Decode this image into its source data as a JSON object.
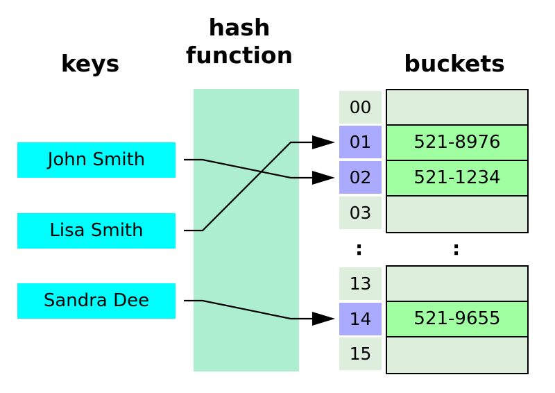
{
  "headings": {
    "keys": "keys",
    "hash_function_line1": "hash",
    "hash_function_line2": "function",
    "buckets": "buckets"
  },
  "keys": [
    {
      "label": "John Smith",
      "bucket": "02"
    },
    {
      "label": "Lisa Smith",
      "bucket": "01"
    },
    {
      "label": "Sandra Dee",
      "bucket": "14"
    }
  ],
  "buckets_top": [
    {
      "index": "00",
      "value": "",
      "hit": false
    },
    {
      "index": "01",
      "value": "521-8976",
      "hit": true
    },
    {
      "index": "02",
      "value": "521-1234",
      "hit": true
    },
    {
      "index": "03",
      "value": "",
      "hit": false
    }
  ],
  "buckets_bottom": [
    {
      "index": "13",
      "value": "",
      "hit": false
    },
    {
      "index": "14",
      "value": "521-9655",
      "hit": true
    },
    {
      "index": "15",
      "value": "",
      "hit": false
    }
  ],
  "ellipsis": ":",
  "colors": {
    "key_fill": "#00ffff",
    "hash_band": "#aeeed0",
    "index_hit": "#aaaaff",
    "index_empty": "#ddeedd",
    "bucket_filled": "#a0ffa0",
    "bucket_empty": "#ddeedd"
  }
}
